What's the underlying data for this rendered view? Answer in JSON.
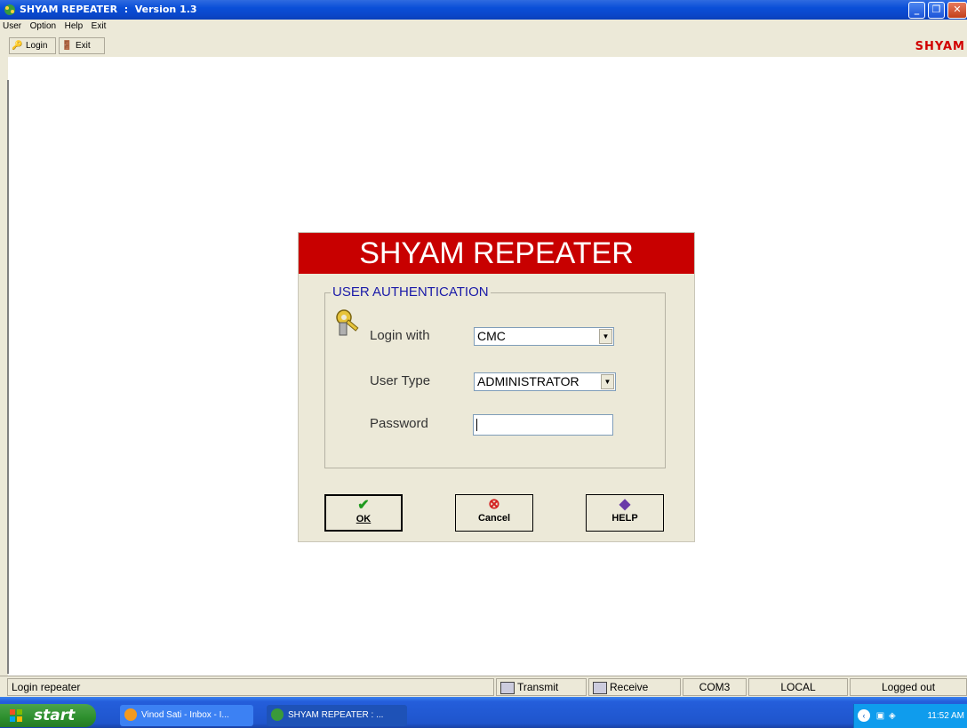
{
  "window": {
    "title": "SHYAM REPEATER  :  Version 1.3"
  },
  "menu": {
    "items": [
      "User",
      "Option",
      "Help",
      "Exit"
    ]
  },
  "toolbar": {
    "login_label": "Login",
    "exit_label": "Exit",
    "brand": "SHYAM"
  },
  "dialog": {
    "header": "SHYAM REPEATER",
    "group_title": "USER AUTHENTICATION",
    "login_with_label": "Login with",
    "login_with_value": "CMC",
    "user_type_label": "User Type",
    "user_type_value": "ADMINISTRATOR",
    "password_label": "Password",
    "password_value": "",
    "ok_label": "OK",
    "cancel_label": "Cancel",
    "help_label": "HELP"
  },
  "status": {
    "message": "Login repeater",
    "transmit": "Transmit",
    "receive": "Receive",
    "port": "COM3",
    "mode": "LOCAL",
    "login_state": "Logged out"
  },
  "taskbar": {
    "start": "start",
    "tasks": [
      "Vinod Sati - Inbox - I...",
      "SHYAM REPEATER  :  ..."
    ],
    "clock": "11:52 AM"
  },
  "colors": {
    "header_red": "#c80000",
    "brand_red": "#d10000",
    "legend_blue": "#1a1aa8",
    "xp_blue": "#0a4fd8"
  }
}
